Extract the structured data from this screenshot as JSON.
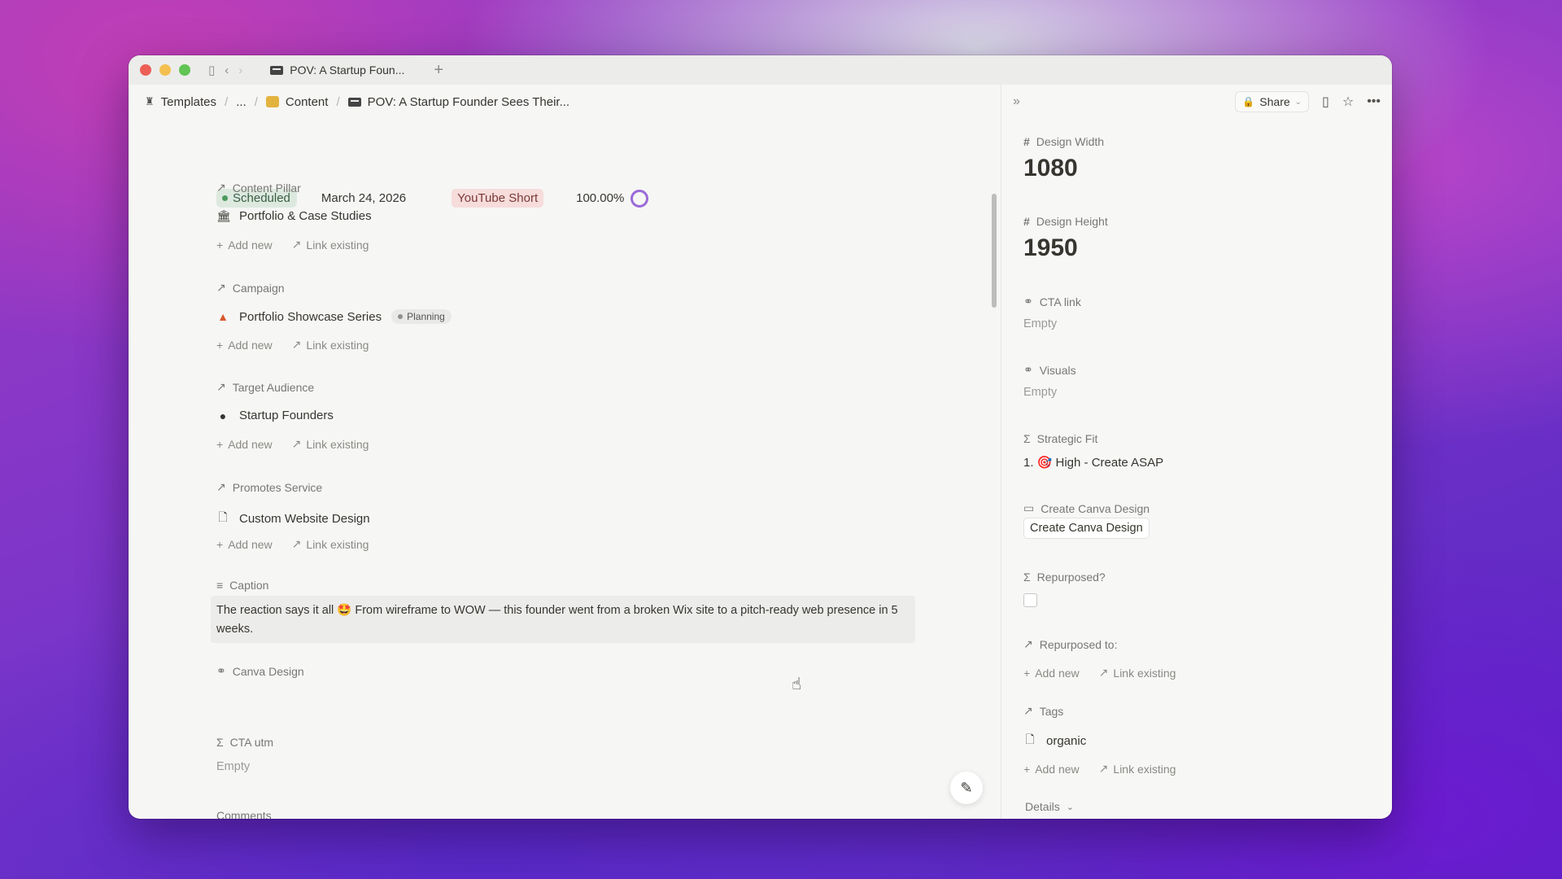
{
  "titlebar": {
    "tab_title": "POV: A Startup Foun...",
    "new_tab": "+"
  },
  "breadcrumb": {
    "items": [
      "Templates",
      "...",
      "Content",
      "POV: A Startup Founder Sees Their..."
    ]
  },
  "toolbar": {
    "share_label": "Share"
  },
  "status": {
    "status": "Scheduled",
    "date": "March 24, 2026",
    "format": "YouTube Short",
    "progress": "100.00%"
  },
  "relations": [
    {
      "label": "Content Pillar",
      "item": "Portfolio & Case Studies",
      "icon": "building-icon",
      "add": "Add new",
      "link": "Link existing"
    },
    {
      "label": "Campaign",
      "item": "Portfolio Showcase Series",
      "badge": "Planning",
      "icon": "warning-icon",
      "add": "Add new",
      "link": "Link existing"
    },
    {
      "label": "Target Audience",
      "item": "Startup Founders",
      "icon": "person-icon",
      "add": "Add new",
      "link": "Link existing"
    },
    {
      "label": "Promotes Service",
      "item": "Custom Website Design",
      "icon": "page-icon",
      "add": "Add new",
      "link": "Link existing"
    }
  ],
  "caption": {
    "label": "Caption",
    "text": "The reaction says it all 🤩 From wireframe to WOW — this founder went from a broken Wix site to a pitch-ready web presence in 5 weeks."
  },
  "canva_design": {
    "label": "Canva Design"
  },
  "cta_utm": {
    "label": "CTA utm",
    "value": "Empty"
  },
  "comments": {
    "label": "Comments"
  },
  "right_panel": {
    "design_width": {
      "label": "Design Width",
      "value": "1080"
    },
    "design_height": {
      "label": "Design Height",
      "value": "1950"
    },
    "cta_link": {
      "label": "CTA link",
      "value": "Empty"
    },
    "visuals": {
      "label": "Visuals",
      "value": "Empty"
    },
    "strategic_fit": {
      "label": "Strategic Fit",
      "value": "1. 🎯 High - Create ASAP"
    },
    "create_canva": {
      "label": "Create Canva Design",
      "button": "Create Canva Design"
    },
    "repurposed": {
      "label": "Repurposed?",
      "checked": false
    },
    "repurposed_to": {
      "label": "Repurposed to:",
      "add": "Add new",
      "link": "Link existing"
    },
    "tags": {
      "label": "Tags",
      "item": "organic",
      "add": "Add new",
      "link": "Link existing"
    },
    "details": {
      "label": "Details"
    }
  },
  "colors": {
    "accent_purple": "#9a6ad8",
    "status_green": "#4d9a5d",
    "format_red": "#f6dcdb"
  }
}
